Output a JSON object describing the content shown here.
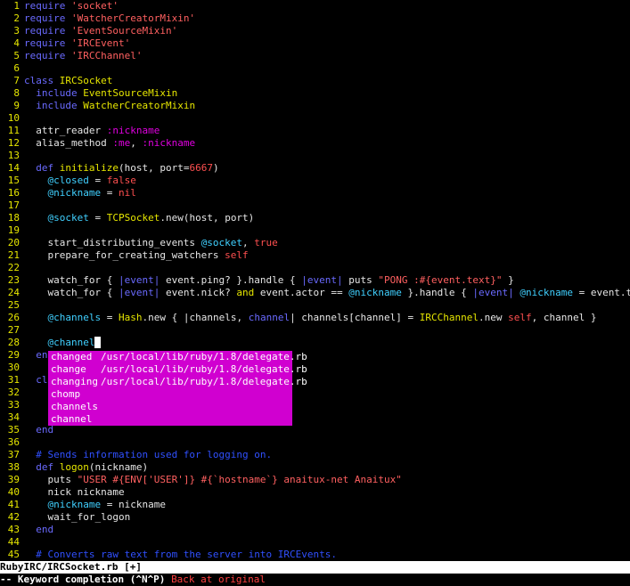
{
  "window": {
    "filename": "RubyIRC/IRCSocket.rb",
    "modified_flag": "[+]"
  },
  "colors": {
    "background": "#000000",
    "line_number": "#e6e600",
    "keyword": "#6a6aff",
    "string": "#ff6060",
    "constant": "#e6e600",
    "instance_var": "#40d0ff",
    "symbol": "#e000e0",
    "comment": "#3050ff",
    "popup": "#d000d0"
  },
  "lines": [
    {
      "n": "1",
      "tokens": [
        {
          "t": "kw",
          "v": "require"
        },
        {
          "t": "txt",
          "v": " "
        },
        {
          "t": "str",
          "v": "'socket'"
        }
      ]
    },
    {
      "n": "2",
      "tokens": [
        {
          "t": "kw",
          "v": "require"
        },
        {
          "t": "txt",
          "v": " "
        },
        {
          "t": "str",
          "v": "'WatcherCreatorMixin'"
        }
      ]
    },
    {
      "n": "3",
      "tokens": [
        {
          "t": "kw",
          "v": "require"
        },
        {
          "t": "txt",
          "v": " "
        },
        {
          "t": "str",
          "v": "'EventSourceMixin'"
        }
      ]
    },
    {
      "n": "4",
      "tokens": [
        {
          "t": "kw",
          "v": "require"
        },
        {
          "t": "txt",
          "v": " "
        },
        {
          "t": "str",
          "v": "'IRCEvent'"
        }
      ]
    },
    {
      "n": "5",
      "tokens": [
        {
          "t": "kw",
          "v": "require"
        },
        {
          "t": "txt",
          "v": " "
        },
        {
          "t": "str",
          "v": "'IRCChannel'"
        }
      ]
    },
    {
      "n": "6",
      "tokens": []
    },
    {
      "n": "7",
      "tokens": [
        {
          "t": "kw",
          "v": "class"
        },
        {
          "t": "txt",
          "v": " "
        },
        {
          "t": "const",
          "v": "IRCSocket"
        }
      ]
    },
    {
      "n": "8",
      "tokens": [
        {
          "t": "txt",
          "v": "  "
        },
        {
          "t": "kw",
          "v": "include"
        },
        {
          "t": "txt",
          "v": " "
        },
        {
          "t": "const",
          "v": "EventSourceMixin"
        }
      ]
    },
    {
      "n": "9",
      "tokens": [
        {
          "t": "txt",
          "v": "  "
        },
        {
          "t": "kw",
          "v": "include"
        },
        {
          "t": "txt",
          "v": " "
        },
        {
          "t": "const",
          "v": "WatcherCreatorMixin"
        }
      ]
    },
    {
      "n": "10",
      "tokens": []
    },
    {
      "n": "11",
      "tokens": [
        {
          "t": "txt",
          "v": "  attr_reader "
        },
        {
          "t": "sym",
          "v": ":nickname"
        }
      ]
    },
    {
      "n": "12",
      "tokens": [
        {
          "t": "txt",
          "v": "  alias_method "
        },
        {
          "t": "sym",
          "v": ":me"
        },
        {
          "t": "txt",
          "v": ", "
        },
        {
          "t": "sym",
          "v": ":nickname"
        }
      ]
    },
    {
      "n": "13",
      "tokens": []
    },
    {
      "n": "14",
      "tokens": [
        {
          "t": "txt",
          "v": "  "
        },
        {
          "t": "kw",
          "v": "def"
        },
        {
          "t": "txt",
          "v": " "
        },
        {
          "t": "const",
          "v": "initialize"
        },
        {
          "t": "txt",
          "v": "(host, port="
        },
        {
          "t": "num",
          "v": "6667"
        },
        {
          "t": "txt",
          "v": ")"
        }
      ]
    },
    {
      "n": "15",
      "tokens": [
        {
          "t": "txt",
          "v": "    "
        },
        {
          "t": "ivar",
          "v": "@closed"
        },
        {
          "t": "txt",
          "v": " = "
        },
        {
          "t": "num",
          "v": "false"
        }
      ]
    },
    {
      "n": "16",
      "tokens": [
        {
          "t": "txt",
          "v": "    "
        },
        {
          "t": "ivar",
          "v": "@nickname"
        },
        {
          "t": "txt",
          "v": " = "
        },
        {
          "t": "num",
          "v": "nil"
        }
      ]
    },
    {
      "n": "17",
      "tokens": []
    },
    {
      "n": "18",
      "tokens": [
        {
          "t": "txt",
          "v": "    "
        },
        {
          "t": "ivar",
          "v": "@socket"
        },
        {
          "t": "txt",
          "v": " = "
        },
        {
          "t": "const",
          "v": "TCPSocket"
        },
        {
          "t": "txt",
          "v": ".new(host, port)"
        }
      ]
    },
    {
      "n": "19",
      "tokens": []
    },
    {
      "n": "20",
      "tokens": [
        {
          "t": "txt",
          "v": "    start_distributing_events "
        },
        {
          "t": "ivar",
          "v": "@socket"
        },
        {
          "t": "txt",
          "v": ", "
        },
        {
          "t": "num",
          "v": "true"
        }
      ]
    },
    {
      "n": "21",
      "tokens": [
        {
          "t": "txt",
          "v": "    prepare_for_creating_watchers "
        },
        {
          "t": "num",
          "v": "self"
        }
      ]
    },
    {
      "n": "22",
      "tokens": []
    },
    {
      "n": "23",
      "tokens": [
        {
          "t": "txt",
          "v": "    watch_for { "
        },
        {
          "t": "kw",
          "v": "|event|"
        },
        {
          "t": "txt",
          "v": " event.ping? }.handle { "
        },
        {
          "t": "kw",
          "v": "|event|"
        },
        {
          "t": "txt",
          "v": " puts "
        },
        {
          "t": "str",
          "v": "\"PONG :#{event.text}\""
        },
        {
          "t": "txt",
          "v": " }"
        }
      ]
    },
    {
      "n": "24",
      "tokens": [
        {
          "t": "txt",
          "v": "    watch_for { "
        },
        {
          "t": "kw",
          "v": "|event|"
        },
        {
          "t": "txt",
          "v": " event.nick? "
        },
        {
          "t": "const",
          "v": "and"
        },
        {
          "t": "txt",
          "v": " event.actor == "
        },
        {
          "t": "ivar",
          "v": "@nickname"
        },
        {
          "t": "txt",
          "v": " }.handle { "
        },
        {
          "t": "kw",
          "v": "|event|"
        },
        {
          "t": "txt",
          "v": " "
        },
        {
          "t": "ivar",
          "v": "@nickname"
        },
        {
          "t": "txt",
          "v": " = event.text }"
        }
      ]
    },
    {
      "n": "25",
      "tokens": []
    },
    {
      "n": "26",
      "tokens": [
        {
          "t": "txt",
          "v": "    "
        },
        {
          "t": "ivar",
          "v": "@channels"
        },
        {
          "t": "txt",
          "v": " = "
        },
        {
          "t": "const",
          "v": "Hash"
        },
        {
          "t": "txt",
          "v": ".new { |channels, "
        },
        {
          "t": "kw",
          "v": "channel"
        },
        {
          "t": "txt",
          "v": "| channels[channel] = "
        },
        {
          "t": "const",
          "v": "IRCChannel"
        },
        {
          "t": "txt",
          "v": ".new "
        },
        {
          "t": "num",
          "v": "self"
        },
        {
          "t": "txt",
          "v": ", channel }"
        }
      ]
    },
    {
      "n": "27",
      "tokens": []
    },
    {
      "n": "28",
      "tokens": [
        {
          "t": "txt",
          "v": "    "
        },
        {
          "t": "ivar",
          "v": "@channel"
        },
        {
          "t": "cursor",
          "v": ""
        }
      ]
    },
    {
      "n": "29",
      "tokens": [
        {
          "t": "txt",
          "v": "  "
        },
        {
          "t": "kw",
          "v": "en"
        }
      ]
    },
    {
      "n": "30",
      "tokens": []
    },
    {
      "n": "31",
      "tokens": [
        {
          "t": "txt",
          "v": "  "
        },
        {
          "t": "kw",
          "v": "cl"
        }
      ]
    },
    {
      "n": "32",
      "tokens": []
    },
    {
      "n": "33",
      "tokens": []
    },
    {
      "n": "34",
      "tokens": []
    },
    {
      "n": "35",
      "tokens": [
        {
          "t": "txt",
          "v": "  "
        },
        {
          "t": "kw",
          "v": "end"
        }
      ]
    },
    {
      "n": "36",
      "tokens": []
    },
    {
      "n": "37",
      "tokens": [
        {
          "t": "txt",
          "v": "  "
        },
        {
          "t": "cmt",
          "v": "# Sends information used for logging on."
        }
      ]
    },
    {
      "n": "38",
      "tokens": [
        {
          "t": "txt",
          "v": "  "
        },
        {
          "t": "kw",
          "v": "def"
        },
        {
          "t": "txt",
          "v": " "
        },
        {
          "t": "const",
          "v": "logon"
        },
        {
          "t": "txt",
          "v": "(nickname)"
        }
      ]
    },
    {
      "n": "39",
      "tokens": [
        {
          "t": "txt",
          "v": "    puts "
        },
        {
          "t": "str",
          "v": "\"USER #{ENV['USER']} #{`hostname`} anaitux-net Anaitux\""
        }
      ]
    },
    {
      "n": "40",
      "tokens": [
        {
          "t": "txt",
          "v": "    nick nickname"
        }
      ]
    },
    {
      "n": "41",
      "tokens": [
        {
          "t": "txt",
          "v": "    "
        },
        {
          "t": "ivar",
          "v": "@nickname"
        },
        {
          "t": "txt",
          "v": " = nickname"
        }
      ]
    },
    {
      "n": "42",
      "tokens": [
        {
          "t": "txt",
          "v": "    wait_for_logon"
        }
      ]
    },
    {
      "n": "43",
      "tokens": [
        {
          "t": "txt",
          "v": "  "
        },
        {
          "t": "kw",
          "v": "end"
        }
      ]
    },
    {
      "n": "44",
      "tokens": []
    },
    {
      "n": "45",
      "tokens": [
        {
          "t": "txt",
          "v": "  "
        },
        {
          "t": "cmt",
          "v": "# Converts raw text from the server into IRCEvents."
        }
      ]
    }
  ],
  "completion_popup": {
    "items": [
      {
        "word": "changed",
        "source": "/usr/local/lib/ruby/1.8/delegate.rb"
      },
      {
        "word": "change",
        "source": "/usr/local/lib/ruby/1.8/delegate.rb"
      },
      {
        "word": "changing",
        "source": "/usr/local/lib/ruby/1.8/delegate.rb"
      },
      {
        "word": "chomp",
        "source": ""
      },
      {
        "word": "channels",
        "source": ""
      },
      {
        "word": "channel",
        "source": ""
      }
    ]
  },
  "cmdline": {
    "mode": "-- Keyword completion (^N^P)",
    "message": "Back at original"
  }
}
